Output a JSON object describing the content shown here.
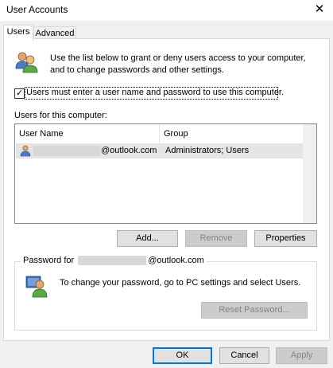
{
  "window": {
    "title": "User Accounts",
    "close_glyph": "✕"
  },
  "tabs": [
    {
      "label": "Users",
      "active": true
    },
    {
      "label": "Advanced",
      "active": false
    }
  ],
  "intro_text": "Use the list below to grant or deny users access to your computer, and to change passwords and other settings.",
  "require_login": {
    "label": "Users must enter a user name and password to use this computer.",
    "checked": true,
    "check_glyph": "✓"
  },
  "users_list": {
    "label": "Users for this computer:",
    "columns": [
      "User Name",
      "Group"
    ],
    "rows": [
      {
        "user_name": "@outlook.com",
        "group": "Administrators; Users"
      }
    ]
  },
  "list_buttons": {
    "add": "Add...",
    "remove": "Remove",
    "properties": "Properties"
  },
  "password_group": {
    "legend_prefix": "Password for",
    "legend_suffix": "@outlook.com",
    "text": "To change your password, go to PC settings and select Users.",
    "reset_button": "Reset Password..."
  },
  "dialog_buttons": {
    "ok": "OK",
    "cancel": "Cancel",
    "apply": "Apply"
  },
  "icons": {
    "users_icon": "users-icon",
    "user_row_icon": "user-icon",
    "password_icon": "user-key-icon"
  }
}
